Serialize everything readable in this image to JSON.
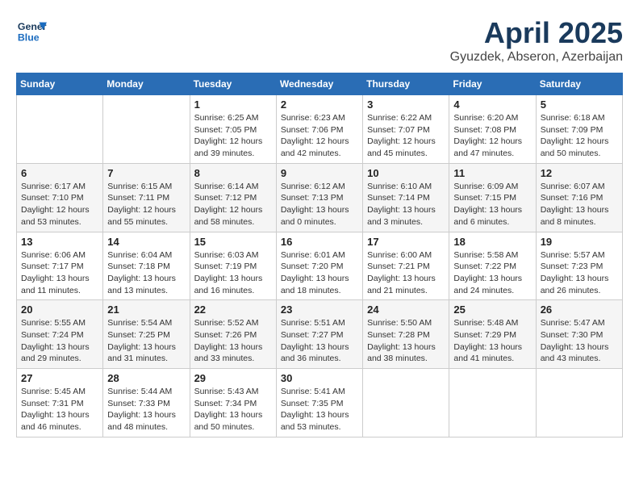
{
  "header": {
    "logo_line1": "General",
    "logo_line2": "Blue",
    "title": "April 2025",
    "subtitle": "Gyuzdek, Abseron, Azerbaijan"
  },
  "columns": [
    "Sunday",
    "Monday",
    "Tuesday",
    "Wednesday",
    "Thursday",
    "Friday",
    "Saturday"
  ],
  "weeks": [
    [
      {
        "day": "",
        "info": ""
      },
      {
        "day": "",
        "info": ""
      },
      {
        "day": "1",
        "info": "Sunrise: 6:25 AM\nSunset: 7:05 PM\nDaylight: 12 hours and 39 minutes."
      },
      {
        "day": "2",
        "info": "Sunrise: 6:23 AM\nSunset: 7:06 PM\nDaylight: 12 hours and 42 minutes."
      },
      {
        "day": "3",
        "info": "Sunrise: 6:22 AM\nSunset: 7:07 PM\nDaylight: 12 hours and 45 minutes."
      },
      {
        "day": "4",
        "info": "Sunrise: 6:20 AM\nSunset: 7:08 PM\nDaylight: 12 hours and 47 minutes."
      },
      {
        "day": "5",
        "info": "Sunrise: 6:18 AM\nSunset: 7:09 PM\nDaylight: 12 hours and 50 minutes."
      }
    ],
    [
      {
        "day": "6",
        "info": "Sunrise: 6:17 AM\nSunset: 7:10 PM\nDaylight: 12 hours and 53 minutes."
      },
      {
        "day": "7",
        "info": "Sunrise: 6:15 AM\nSunset: 7:11 PM\nDaylight: 12 hours and 55 minutes."
      },
      {
        "day": "8",
        "info": "Sunrise: 6:14 AM\nSunset: 7:12 PM\nDaylight: 12 hours and 58 minutes."
      },
      {
        "day": "9",
        "info": "Sunrise: 6:12 AM\nSunset: 7:13 PM\nDaylight: 13 hours and 0 minutes."
      },
      {
        "day": "10",
        "info": "Sunrise: 6:10 AM\nSunset: 7:14 PM\nDaylight: 13 hours and 3 minutes."
      },
      {
        "day": "11",
        "info": "Sunrise: 6:09 AM\nSunset: 7:15 PM\nDaylight: 13 hours and 6 minutes."
      },
      {
        "day": "12",
        "info": "Sunrise: 6:07 AM\nSunset: 7:16 PM\nDaylight: 13 hours and 8 minutes."
      }
    ],
    [
      {
        "day": "13",
        "info": "Sunrise: 6:06 AM\nSunset: 7:17 PM\nDaylight: 13 hours and 11 minutes."
      },
      {
        "day": "14",
        "info": "Sunrise: 6:04 AM\nSunset: 7:18 PM\nDaylight: 13 hours and 13 minutes."
      },
      {
        "day": "15",
        "info": "Sunrise: 6:03 AM\nSunset: 7:19 PM\nDaylight: 13 hours and 16 minutes."
      },
      {
        "day": "16",
        "info": "Sunrise: 6:01 AM\nSunset: 7:20 PM\nDaylight: 13 hours and 18 minutes."
      },
      {
        "day": "17",
        "info": "Sunrise: 6:00 AM\nSunset: 7:21 PM\nDaylight: 13 hours and 21 minutes."
      },
      {
        "day": "18",
        "info": "Sunrise: 5:58 AM\nSunset: 7:22 PM\nDaylight: 13 hours and 24 minutes."
      },
      {
        "day": "19",
        "info": "Sunrise: 5:57 AM\nSunset: 7:23 PM\nDaylight: 13 hours and 26 minutes."
      }
    ],
    [
      {
        "day": "20",
        "info": "Sunrise: 5:55 AM\nSunset: 7:24 PM\nDaylight: 13 hours and 29 minutes."
      },
      {
        "day": "21",
        "info": "Sunrise: 5:54 AM\nSunset: 7:25 PM\nDaylight: 13 hours and 31 minutes."
      },
      {
        "day": "22",
        "info": "Sunrise: 5:52 AM\nSunset: 7:26 PM\nDaylight: 13 hours and 33 minutes."
      },
      {
        "day": "23",
        "info": "Sunrise: 5:51 AM\nSunset: 7:27 PM\nDaylight: 13 hours and 36 minutes."
      },
      {
        "day": "24",
        "info": "Sunrise: 5:50 AM\nSunset: 7:28 PM\nDaylight: 13 hours and 38 minutes."
      },
      {
        "day": "25",
        "info": "Sunrise: 5:48 AM\nSunset: 7:29 PM\nDaylight: 13 hours and 41 minutes."
      },
      {
        "day": "26",
        "info": "Sunrise: 5:47 AM\nSunset: 7:30 PM\nDaylight: 13 hours and 43 minutes."
      }
    ],
    [
      {
        "day": "27",
        "info": "Sunrise: 5:45 AM\nSunset: 7:31 PM\nDaylight: 13 hours and 46 minutes."
      },
      {
        "day": "28",
        "info": "Sunrise: 5:44 AM\nSunset: 7:33 PM\nDaylight: 13 hours and 48 minutes."
      },
      {
        "day": "29",
        "info": "Sunrise: 5:43 AM\nSunset: 7:34 PM\nDaylight: 13 hours and 50 minutes."
      },
      {
        "day": "30",
        "info": "Sunrise: 5:41 AM\nSunset: 7:35 PM\nDaylight: 13 hours and 53 minutes."
      },
      {
        "day": "",
        "info": ""
      },
      {
        "day": "",
        "info": ""
      },
      {
        "day": "",
        "info": ""
      }
    ]
  ]
}
